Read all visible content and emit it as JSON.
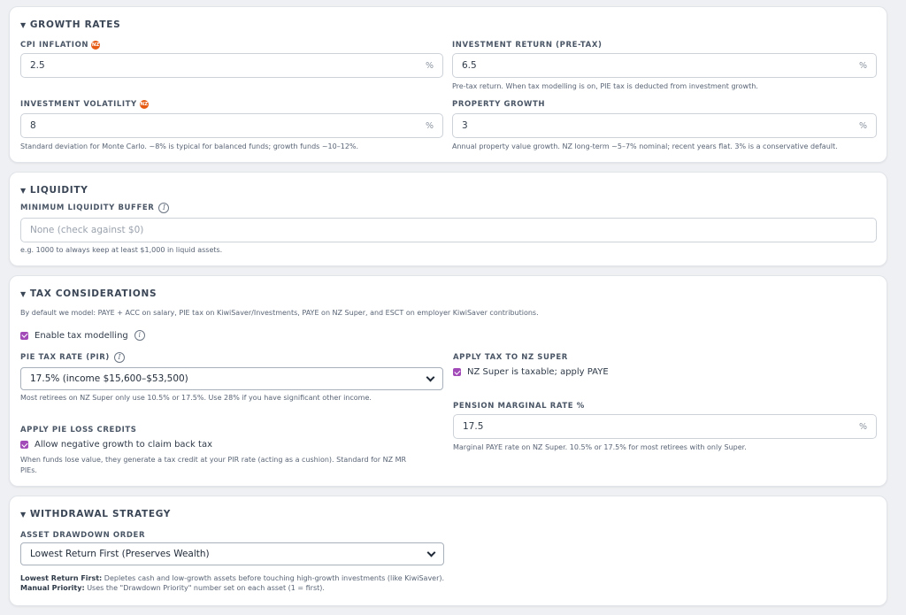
{
  "growth": {
    "title": "GROWTH RATES",
    "cpi": {
      "label": "CPI INFLATION",
      "value": "2.5",
      "unit": "%",
      "warn_icon": "warning-badge-icon",
      "warn_text": "NZ"
    },
    "investment_return": {
      "label": "INVESTMENT RETURN (PRE-TAX)",
      "value": "6.5",
      "unit": "%",
      "help": "Pre-tax return. When tax modelling is on, PIE tax is deducted from investment growth."
    },
    "volatility": {
      "label": "INVESTMENT VOLATILITY",
      "value": "8",
      "unit": "%",
      "warn_text": "NZ",
      "help": "Standard deviation for Monte Carlo. ~8% is typical for balanced funds; growth funds ~10–12%."
    },
    "property": {
      "label": "PROPERTY GROWTH",
      "value": "3",
      "unit": "%",
      "help": "Annual property value growth. NZ long-term ~5–7% nominal; recent years flat. 3% is a conservative default."
    }
  },
  "liquidity": {
    "title": "LIQUIDITY",
    "buffer": {
      "label": "MINIMUM LIQUIDITY BUFFER",
      "placeholder": "None (check against $0)",
      "help": "e.g. 1000 to always keep at least $1,000 in liquid assets."
    }
  },
  "tax": {
    "title": "TAX CONSIDERATIONS",
    "intro": "By default we model: PAYE + ACC on salary, PIE tax on KiwiSaver/Investments, PAYE on NZ Super, and ESCT on employer KiwiSaver contributions.",
    "enable_label": "Enable tax modelling",
    "pir": {
      "label": "PIE TAX RATE (PIR)",
      "selected": "17.5% (income $15,600–$53,500)",
      "help": "Most retirees on NZ Super only use 10.5% or 17.5%. Use 28% if you have significant other income."
    },
    "super_tax": {
      "label": "APPLY TAX TO NZ SUPER",
      "check_label": "NZ Super is taxable; apply PAYE"
    },
    "loss_credits": {
      "label": "APPLY PIE LOSS CREDITS",
      "check_label": "Allow negative growth to claim back tax",
      "help": "When funds lose value, they generate a tax credit at your PIR rate (acting as a cushion). Standard for NZ MR PIEs."
    },
    "pension_rate": {
      "label": "PENSION MARGINAL RATE %",
      "value": "17.5",
      "unit": "%",
      "help": "Marginal PAYE rate on NZ Super. 10.5% or 17.5% for most retirees with only Super."
    }
  },
  "withdrawal": {
    "title": "WITHDRAWAL STRATEGY",
    "order": {
      "label": "ASSET DRAWDOWN ORDER",
      "selected": "Lowest Return First (Preserves Wealth)"
    },
    "note1_bold": "Lowest Return First:",
    "note1_text": " Depletes cash and low-growth assets before touching high-growth investments (like KiwiSaver).",
    "note2_bold": "Manual Priority:",
    "note2_text": " Uses the \"Drawdown Priority\" number set on each asset (1 = first)."
  },
  "colors": {
    "checkbox": "#a24ab8",
    "warning": "#e65a14"
  }
}
